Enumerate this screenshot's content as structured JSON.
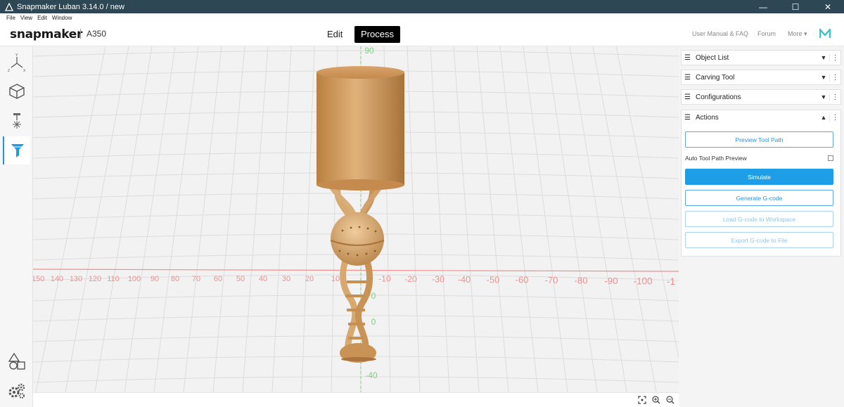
{
  "window": {
    "title": "Snapmaker Luban 3.14.0 / new",
    "controls": [
      "—",
      "☐",
      "✕"
    ]
  },
  "menu": [
    "File",
    "View",
    "Edit",
    "Window"
  ],
  "header": {
    "logo": "snapmaker",
    "machine": "A350",
    "tabs": {
      "edit": "Edit",
      "process": "Process"
    },
    "links": {
      "manual": "User Manual & FAQ",
      "forum": "Forum",
      "more": "More ▾"
    }
  },
  "viewport": {
    "x_ticks": [
      "150",
      "140",
      "130",
      "120",
      "110",
      "100",
      "90",
      "80",
      "70",
      "60",
      "50",
      "40",
      "30",
      "20",
      "10",
      "-10",
      "-20",
      "-30",
      "-40",
      "-50",
      "-60",
      "-70",
      "-80",
      "-90",
      "-100",
      "-1"
    ],
    "y_ticks": [
      "90",
      "0",
      "0",
      "-40"
    ],
    "colors": {
      "x_axis": "#f08f8f",
      "y_axis": "#7fcf7f",
      "grid": "#dcdcdc",
      "wood": "#c9955b"
    }
  },
  "panel": {
    "sections": {
      "object_list": "Object List",
      "carving_tool": "Carving Tool",
      "configurations": "Configurations",
      "actions": "Actions"
    },
    "actions": {
      "preview": "Preview Tool Path",
      "auto_preview": "Auto Tool Path Preview",
      "simulate": "Simulate",
      "generate": "Generate G-code",
      "load": "Load G-code to Workspace",
      "export": "Export G-code to File"
    }
  }
}
